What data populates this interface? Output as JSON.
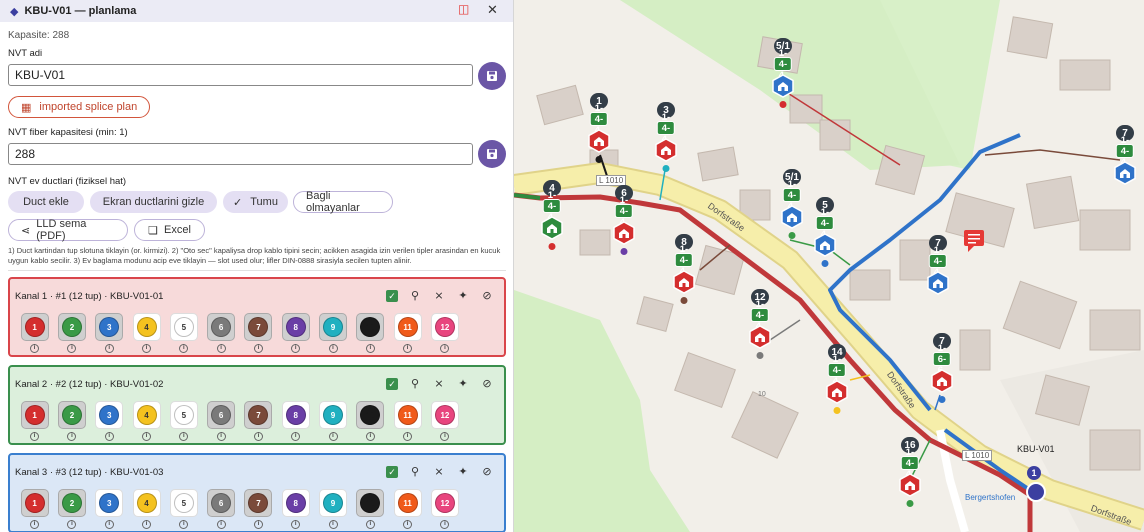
{
  "panel": {
    "title": "KBU-V01 — planlama",
    "capacity": "Kapasite: 288",
    "nvt_name_label": "NVT adi",
    "nvt_name_value": "KBU-V01",
    "imported_label": "imported splice plan",
    "fiber_cap_label": "NVT fiber kapasitesi (min: 1)",
    "fiber_cap_value": "288",
    "ducts_label": "NVT ev ductlari (fiziksel hat)",
    "btn_duct_add": "Duct ekle",
    "btn_hide_ducts": "Ekran ductlarini gizle",
    "btn_all": "Tumu",
    "btn_unconnected": "Bagli olmayanlar",
    "btn_lld": "LLD sema (PDF)",
    "btn_excel": "Excel",
    "help_text": "1) Duct kartindan tup slotuna tiklayin (or. kirmizi). 2) \"Oto sec\" kapaliysa drop kablo tipini secin; acikken asagida izin verilen tipler arasindan en kucuk uygun kablo secilir. 3) Ev baglama modunu acip eve tiklayin — slot used olur; lifler DIN-0888 sirasiyla secilen tupten alinir."
  },
  "tube_colors": [
    {
      "n": "1",
      "bg": "#d42e2e",
      "fg": "#ffffff"
    },
    {
      "n": "2",
      "bg": "#3a9a46",
      "fg": "#ffffff"
    },
    {
      "n": "3",
      "bg": "#2f73c9",
      "fg": "#ffffff"
    },
    {
      "n": "4",
      "bg": "#f4c21f",
      "fg": "#333333"
    },
    {
      "n": "5",
      "bg": "#ffffff",
      "fg": "#333333"
    },
    {
      "n": "6",
      "bg": "#7a7a7a",
      "fg": "#ffffff"
    },
    {
      "n": "7",
      "bg": "#7a4a3a",
      "fg": "#ffffff"
    },
    {
      "n": "8",
      "bg": "#6a3ea6",
      "fg": "#ffffff"
    },
    {
      "n": "9",
      "bg": "#20b0c0",
      "fg": "#ffffff"
    },
    {
      "n": "10",
      "bg": "#1a1a1a",
      "fg": "#1a1a1a"
    },
    {
      "n": "11",
      "bg": "#f05a1a",
      "fg": "#ffffff"
    },
    {
      "n": "12",
      "bg": "#e8457e",
      "fg": "#ffffff"
    }
  ],
  "kanals": [
    {
      "title": "Kanal 1 · #1 (12 tup) · KBU-V01-01",
      "theme": "red",
      "gray": [
        1,
        2,
        3,
        6,
        7,
        8,
        9,
        10
      ]
    },
    {
      "title": "Kanal 2 · #2 (12 tup) · KBU-V01-02",
      "theme": "green",
      "gray": [
        1,
        2,
        6,
        7,
        10
      ]
    },
    {
      "title": "Kanal 3 · #3 (12 tup) · KBU-V01-03",
      "theme": "blue",
      "gray": [
        1,
        2,
        6,
        7,
        10
      ]
    }
  ],
  "map": {
    "street_labels": [
      "Dorfstraße",
      "Dorfstraße",
      "Dorfstraße",
      "L 1010",
      "L 1010"
    ],
    "place_label": "Bergertshofen",
    "nvt_label": "KBU-V01",
    "nvt_num": "1",
    "house_number": "10",
    "pins": [
      {
        "num": "5/1",
        "badge": "1-4-4",
        "house": "blue",
        "dot": "#d42e2e"
      },
      {
        "num": "1",
        "badge": "1-4-4",
        "house": "red",
        "dot": "#1a1a1a"
      },
      {
        "num": "3",
        "badge": "1-4-4",
        "house": "red",
        "dot": "#20b0c0"
      },
      {
        "num": "4",
        "badge": "1-4-4",
        "house": "green",
        "dot": "#d42e2e"
      },
      {
        "num": "6",
        "badge": "1-4-4",
        "house": "red",
        "dot": "#6a3ea6"
      },
      {
        "num": "5/1",
        "badge": "1-4-4",
        "house": "blue",
        "dot": "#3a9a46"
      },
      {
        "num": "5",
        "badge": "1-4-4",
        "house": "blue",
        "dot": "#2f73c9"
      },
      {
        "num": "8",
        "badge": "1-4-4",
        "house": "red",
        "dot": "#7a4a3a"
      },
      {
        "num": "12",
        "badge": "1-4-4",
        "house": "red",
        "dot": "#7a7a7a"
      },
      {
        "num": "14",
        "badge": "1-4-4",
        "house": "red",
        "dot": "#f4c21f"
      },
      {
        "num": "7",
        "badge": "1-4-4",
        "house": "blue",
        "dot": ""
      },
      {
        "num": "7",
        "badge": "1-6-6",
        "house": "red",
        "dot": "#2f73c9"
      },
      {
        "num": "16",
        "badge": "1-4-4",
        "house": "red",
        "dot": "#3a9a46"
      },
      {
        "num": "7",
        "badge": "1-4-4",
        "house": "blue",
        "dot": ""
      }
    ]
  }
}
